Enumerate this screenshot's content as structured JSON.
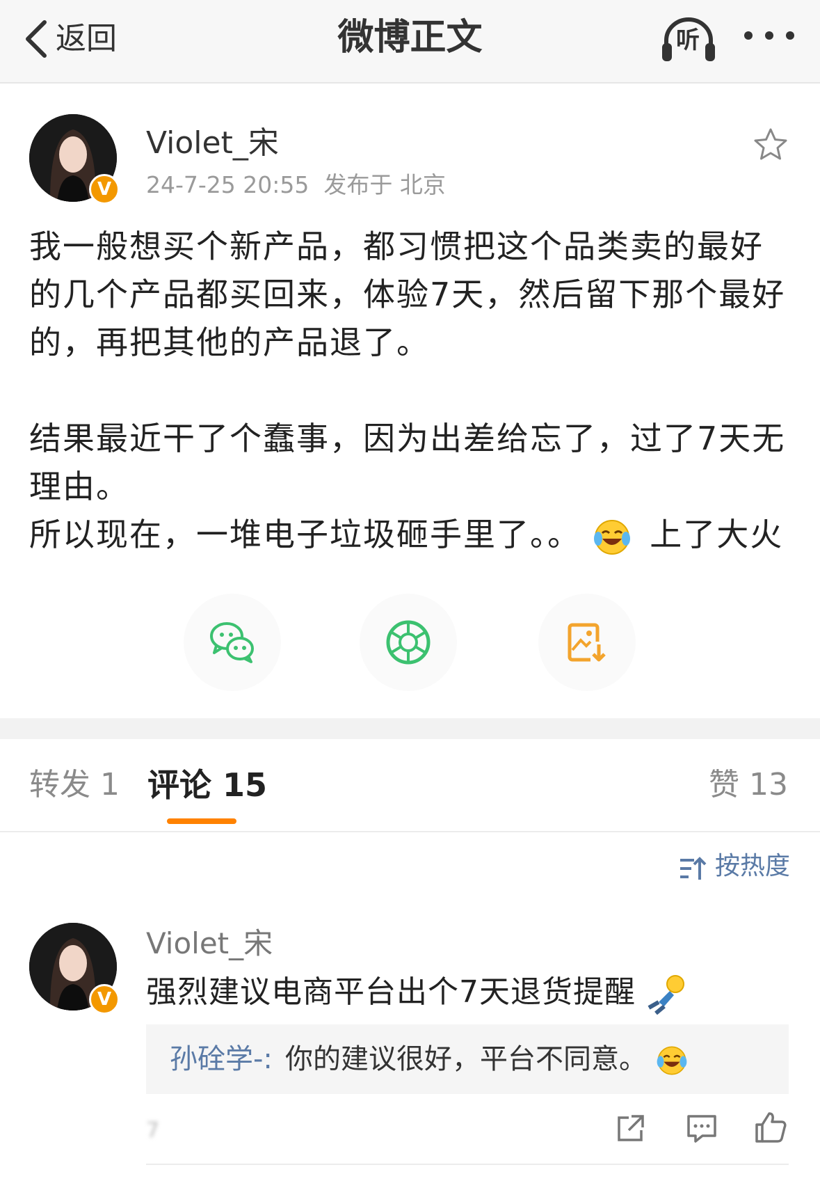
{
  "nav": {
    "back_label": "返回",
    "title": "微博正文",
    "listen_label": "听"
  },
  "post": {
    "author": "Violet_宋",
    "verified_badge": "V",
    "time": "24-7-25 20:55",
    "location": "发布于 北京",
    "paragraphs": [
      "我一般想买个新产品，都习惯把这个品类卖的最好的几个产品都买回来，体验7天，然后留下那个最好的，再把其他的产品退了。",
      "结果最近干了个蠢事，因为出差给忘了，过了7天无理由。",
      "所以现在，一堆电子垃圾砸手里了。。",
      "上了大火"
    ]
  },
  "tabs": {
    "repost": "转发 1",
    "comment": "评论 15",
    "likes": "赞 13"
  },
  "sort": {
    "label": "按热度"
  },
  "comment": {
    "author": "Violet_宋",
    "verified_badge": "V",
    "text": "强烈建议电商平台出个7天退货提醒",
    "reply_user": "孙硂学-:",
    "reply_text": "你的建议很好，平台不同意。",
    "meta_blurred": "7"
  },
  "colors": {
    "accent": "#ff8200",
    "link": "#5a7aa6",
    "wechat": "#3cc170",
    "save": "#f3a42d",
    "verified": "#f39800"
  },
  "icons": [
    "chevron-left-icon",
    "headphones-icon",
    "more-icon",
    "star-icon",
    "wechat-icon",
    "moments-icon",
    "save-image-icon",
    "sort-icon",
    "share-icon",
    "comment-icon",
    "like-icon",
    "laugh-cry-emoji",
    "fallen-man-emoji"
  ]
}
